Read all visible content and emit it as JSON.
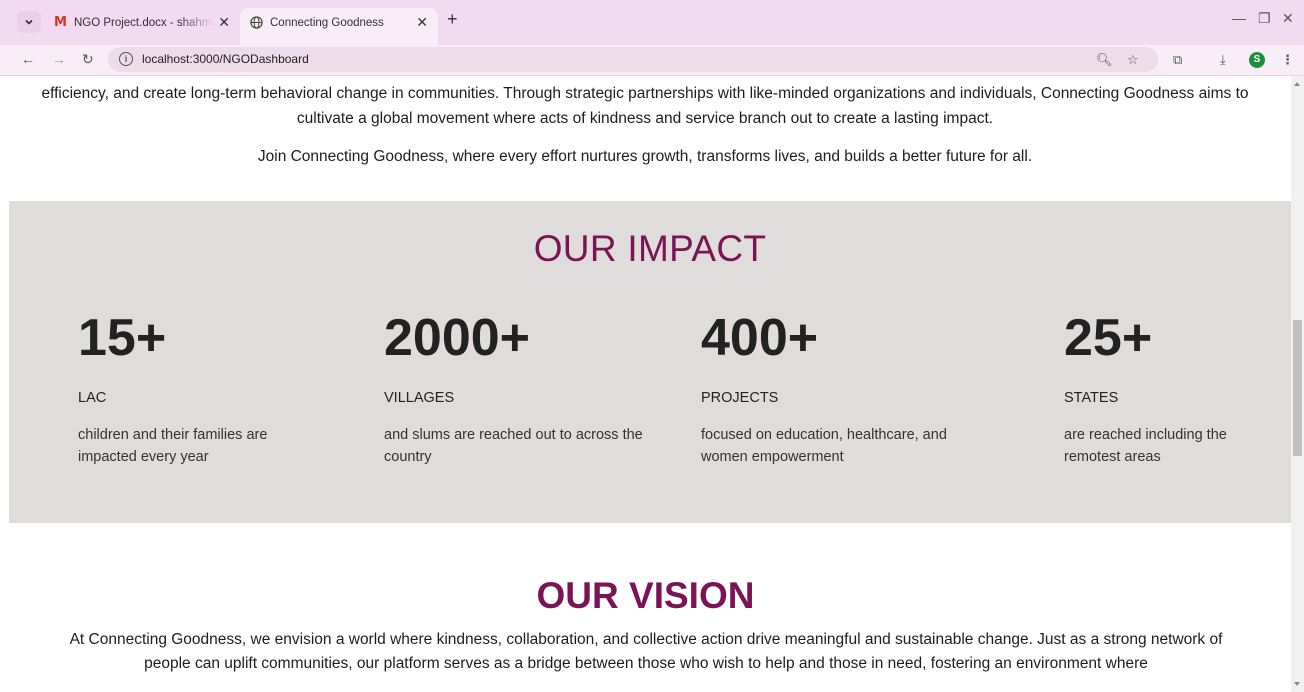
{
  "browser": {
    "tabs": [
      {
        "title": "NGO Project.docx - shahmiloni",
        "active": false,
        "icon": "gmail-icon"
      },
      {
        "title": "Connecting Goodness",
        "active": true,
        "icon": "globe-icon"
      }
    ],
    "new_tab": "+",
    "url": "localhost:3000/NGODashboard",
    "profile_initial": "S",
    "colors": {
      "tabbar": "#f2daf0",
      "toolbar": "#f9eef7",
      "profile": "#1e8e3e"
    }
  },
  "page": {
    "intro": {
      "paragraph1": "efficiency, and create long-term behavioral change in communities. Through strategic partnerships with like-minded organizations and individuals, Connecting Goodness aims to cultivate a global movement where acts of kindness and service branch out to create a lasting impact.",
      "paragraph2": "Join Connecting Goodness, where every effort nurtures growth, transforms lives, and builds a better future for all."
    },
    "impact": {
      "title": "OUR IMPACT",
      "stats": [
        {
          "number": "15+",
          "label": "LAC",
          "description": "children and their families are impacted every year"
        },
        {
          "number": "2000+",
          "label": "VILLAGES",
          "description": "and slums are reached out to across the country"
        },
        {
          "number": "400+",
          "label": "PROJECTS",
          "description": "focused on education, healthcare, and women empowerment"
        },
        {
          "number": "25+",
          "label": "STATES",
          "description": "are reached including the remotest areas"
        }
      ],
      "colors": {
        "background": "#e0dcdc",
        "title": "#7b1456"
      }
    },
    "vision": {
      "title": "OUR VISION",
      "paragraph": "At Connecting Goodness, we envision a world where kindness, collaboration, and collective action drive meaningful and sustainable change. Just as a strong network of people can uplift communities, our platform serves as a bridge between those who wish to help and those in need, fostering an environment where"
    }
  }
}
